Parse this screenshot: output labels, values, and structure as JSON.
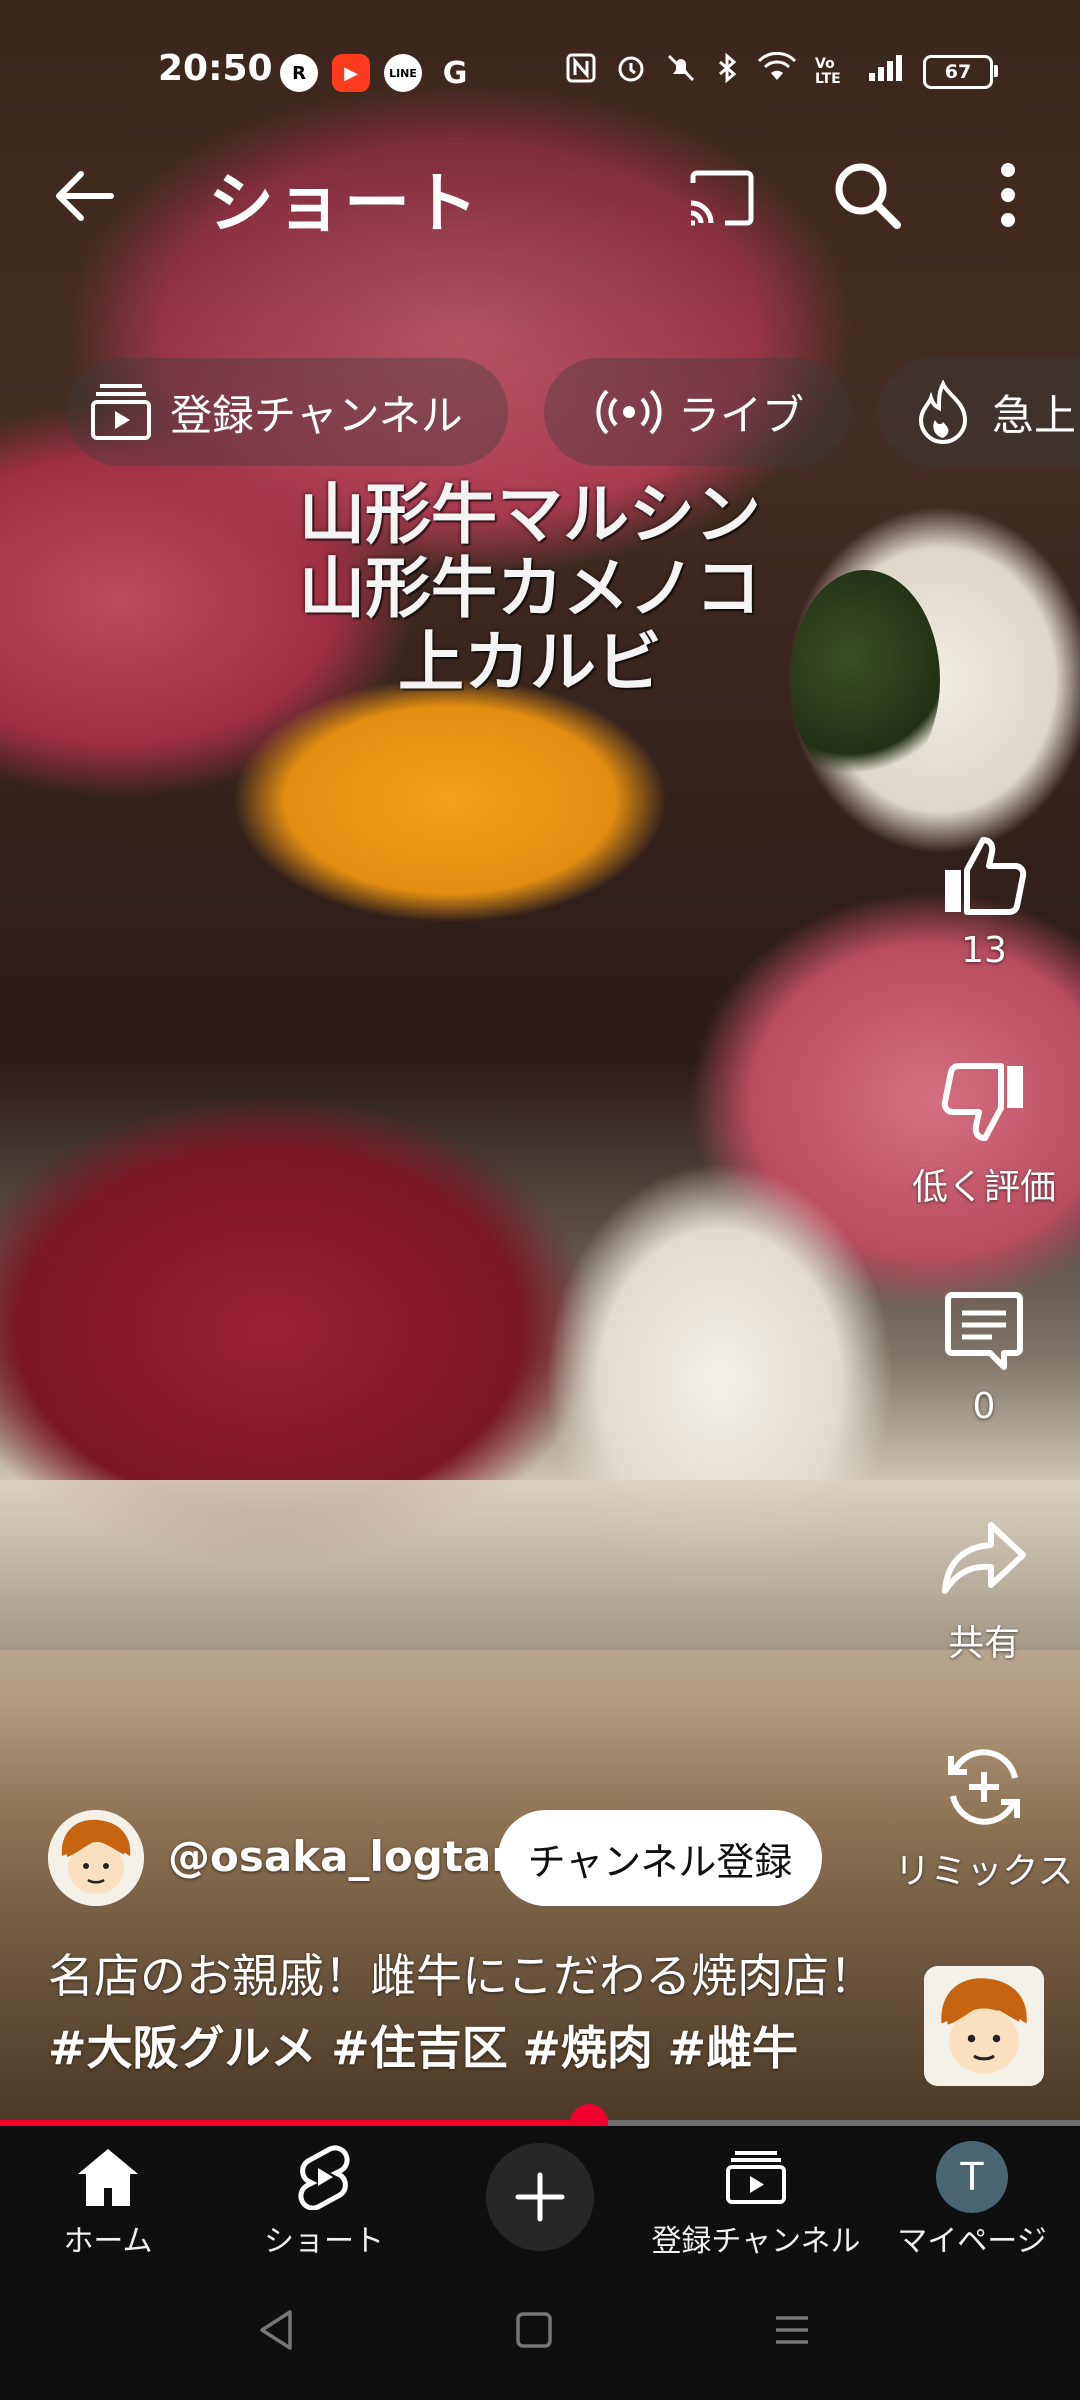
{
  "status_bar": {
    "time": "20:50",
    "app_icons": [
      "rakuten-link-icon",
      "red-play-icon",
      "line-icon",
      "google-icon"
    ],
    "app_icon_labels": [
      "R",
      "▶",
      "LINE",
      "G"
    ],
    "battery": "67",
    "network_label": "Vo LTE"
  },
  "app_bar": {
    "title": "ショート"
  },
  "chips": [
    {
      "label": "登録チャンネル",
      "icon": "subscriptions-icon"
    },
    {
      "label": "ライブ",
      "icon": "live-icon"
    },
    {
      "label": "急上",
      "icon": "trending-icon"
    }
  ],
  "video": {
    "overlay_lines": [
      "山形牛マルシン",
      "山形牛カメノコ",
      "上カルビ"
    ],
    "progress": 0.545
  },
  "actions": {
    "like_count": "13",
    "dislike_label": "低く評価",
    "comment_count": "0",
    "share_label": "共有",
    "remix_label": "リミックス"
  },
  "channel": {
    "handle": "@osaka_logtaro",
    "subscribe_label": "チャンネル登録"
  },
  "description": {
    "text": "名店のお親戚！雌牛にこだわる焼肉店！",
    "hashtags": [
      "#大阪グルメ",
      "#住吉区",
      "#焼肉",
      "#雌牛"
    ]
  },
  "bottom_nav": {
    "home": "ホーム",
    "shorts": "ショート",
    "subscriptions": "登録チャンネル",
    "mypage": "マイページ",
    "avatar_letter": "T"
  },
  "colors": {
    "accent": "#f1002c",
    "nav_bg": "#0f0f0f"
  }
}
